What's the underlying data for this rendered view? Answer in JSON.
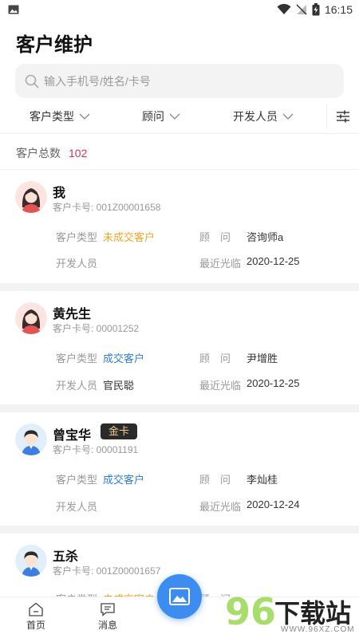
{
  "status_bar": {
    "time": "16:15"
  },
  "page_title": "客户维护",
  "search": {
    "placeholder": "输入手机号/姓名/卡号",
    "value": ""
  },
  "filters": [
    {
      "label": "客户类型"
    },
    {
      "label": "顾问"
    },
    {
      "label": "开发人员"
    }
  ],
  "summary": {
    "label": "客户总数",
    "count": "102"
  },
  "field_labels": {
    "type": "客户类型",
    "advisor": "顾　问",
    "developer": "开发人员",
    "last_visit": "最近光临",
    "card_prefix": "客户卡号: "
  },
  "customers": [
    {
      "name": "我",
      "card_no": "001Z00001658",
      "badge": "",
      "type": "未成交客户",
      "type_status": "unclosed",
      "advisor": "咨询师a",
      "developer": "",
      "last_visit": "2020-12-25",
      "avatar": "female-avatar-icon"
    },
    {
      "name": "黄先生",
      "card_no": "00001252",
      "badge": "",
      "type": "成交客户",
      "type_status": "closed",
      "advisor": "尹增胜",
      "developer": "官民聪",
      "last_visit": "2020-12-25",
      "avatar": "female-avatar-icon"
    },
    {
      "name": "曾宝华",
      "card_no": "00001191",
      "badge": "金卡",
      "type": "成交客户",
      "type_status": "closed",
      "advisor": "李灿桂",
      "developer": "",
      "last_visit": "2020-12-24",
      "avatar": "male-avatar-icon"
    },
    {
      "name": "五杀",
      "card_no": "001Z00001657",
      "badge": "",
      "type": "未成交客户",
      "type_status": "unclosed",
      "advisor": "",
      "developer": "",
      "last_visit": "",
      "avatar": "male-avatar-icon"
    }
  ],
  "tabbar": {
    "home": "首页",
    "messages": "消息"
  },
  "watermark": {
    "number": "96",
    "text": "下载站",
    "url": "WWW.96XZ.COM"
  },
  "colors": {
    "accent_blue": "#3d8cf0",
    "count_red": "#e0324b",
    "unclosed_orange": "#f5a623",
    "closed_blue": "#2d7fd3",
    "badge_gold": "#f2cf8c"
  }
}
